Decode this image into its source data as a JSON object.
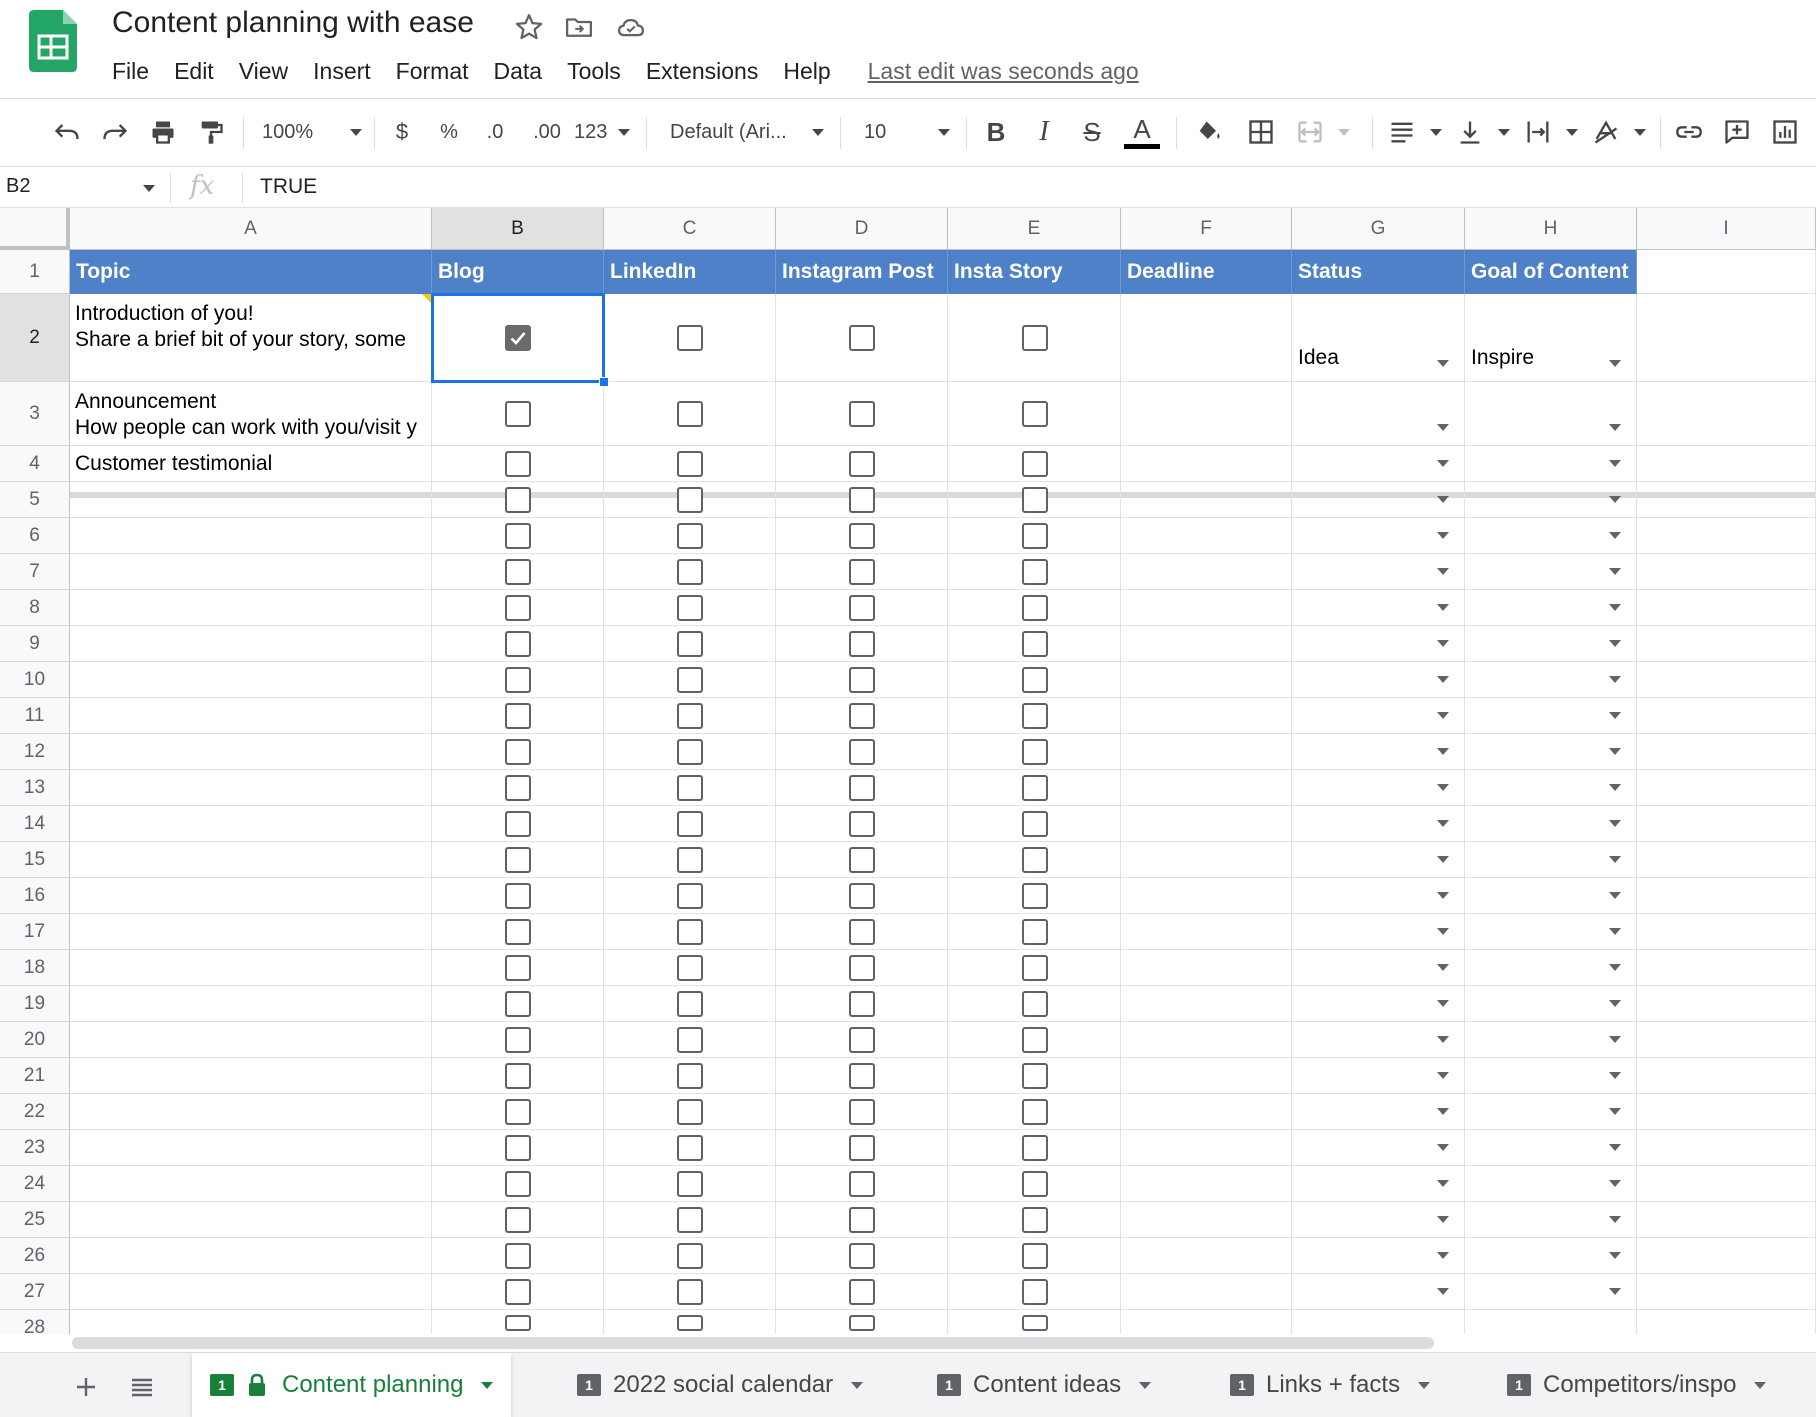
{
  "app": {
    "title": "Content planning with ease",
    "last_edit": "Last edit was seconds ago",
    "menu": [
      "File",
      "Edit",
      "View",
      "Insert",
      "Format",
      "Data",
      "Tools",
      "Extensions",
      "Help"
    ]
  },
  "toolbar": {
    "zoom": "100%",
    "currency": "$",
    "percent": "%",
    "decrease_decimal": ".0",
    "increase_decimal": ".00",
    "more_formats": "123",
    "font": "Default (Ari...",
    "font_size": "10",
    "bold": "B",
    "italic": "I",
    "strikethrough": "S",
    "text_color": "A"
  },
  "formula_bar": {
    "cell_ref": "B2",
    "fx": "fx",
    "value": "TRUE"
  },
  "grid": {
    "columns": [
      "A",
      "B",
      "C",
      "D",
      "E",
      "F",
      "G",
      "H",
      "I"
    ],
    "selected_column": "B",
    "selected_row": "2",
    "header_row": [
      "Topic",
      "Blog",
      "LinkedIn",
      "Instagram Post",
      "Insta Story",
      "Deadline",
      "Status",
      "Goal of Content"
    ],
    "row_numbers": [
      "1",
      "2",
      "3",
      "4",
      "5",
      "6",
      "7",
      "8",
      "9",
      "10",
      "11",
      "12",
      "13",
      "14",
      "15",
      "16",
      "17",
      "18",
      "19",
      "20",
      "21",
      "22",
      "23",
      "24",
      "25",
      "26",
      "27",
      "28"
    ],
    "rows": [
      {
        "topic_line1": "Introduction of you!",
        "topic_line2": "Share a brief bit of your story, some",
        "blog": true,
        "linkedin": false,
        "instagram_post": false,
        "insta_story": false,
        "deadline": "",
        "status": "Idea",
        "goal": "Inspire"
      },
      {
        "topic_line1": "Announcement",
        "topic_line2": "How people can work with you/visit y",
        "blog": false,
        "linkedin": false,
        "instagram_post": false,
        "insta_story": false,
        "deadline": "",
        "status": "",
        "goal": ""
      },
      {
        "topic_line1": "Customer testimonial",
        "topic_line2": "",
        "blog": false,
        "linkedin": false,
        "instagram_post": false,
        "insta_story": false,
        "deadline": "",
        "status": "",
        "goal": ""
      }
    ]
  },
  "sheet_tabs": [
    {
      "label": "Content planning",
      "active": true,
      "locked": true,
      "badge": "1"
    },
    {
      "label": "2022 social calendar",
      "active": false,
      "locked": false,
      "badge": "1"
    },
    {
      "label": "Content ideas",
      "active": false,
      "locked": false,
      "badge": "1"
    },
    {
      "label": "Links + facts",
      "active": false,
      "locked": false,
      "badge": "1"
    },
    {
      "label": "Competitors/inspo",
      "active": false,
      "locked": false,
      "badge": "1"
    }
  ],
  "colors": {
    "header_fill": "#4f81c9",
    "selection": "#1a73e8",
    "active_tab": "#188038",
    "sheets_brand": "#23a566"
  }
}
